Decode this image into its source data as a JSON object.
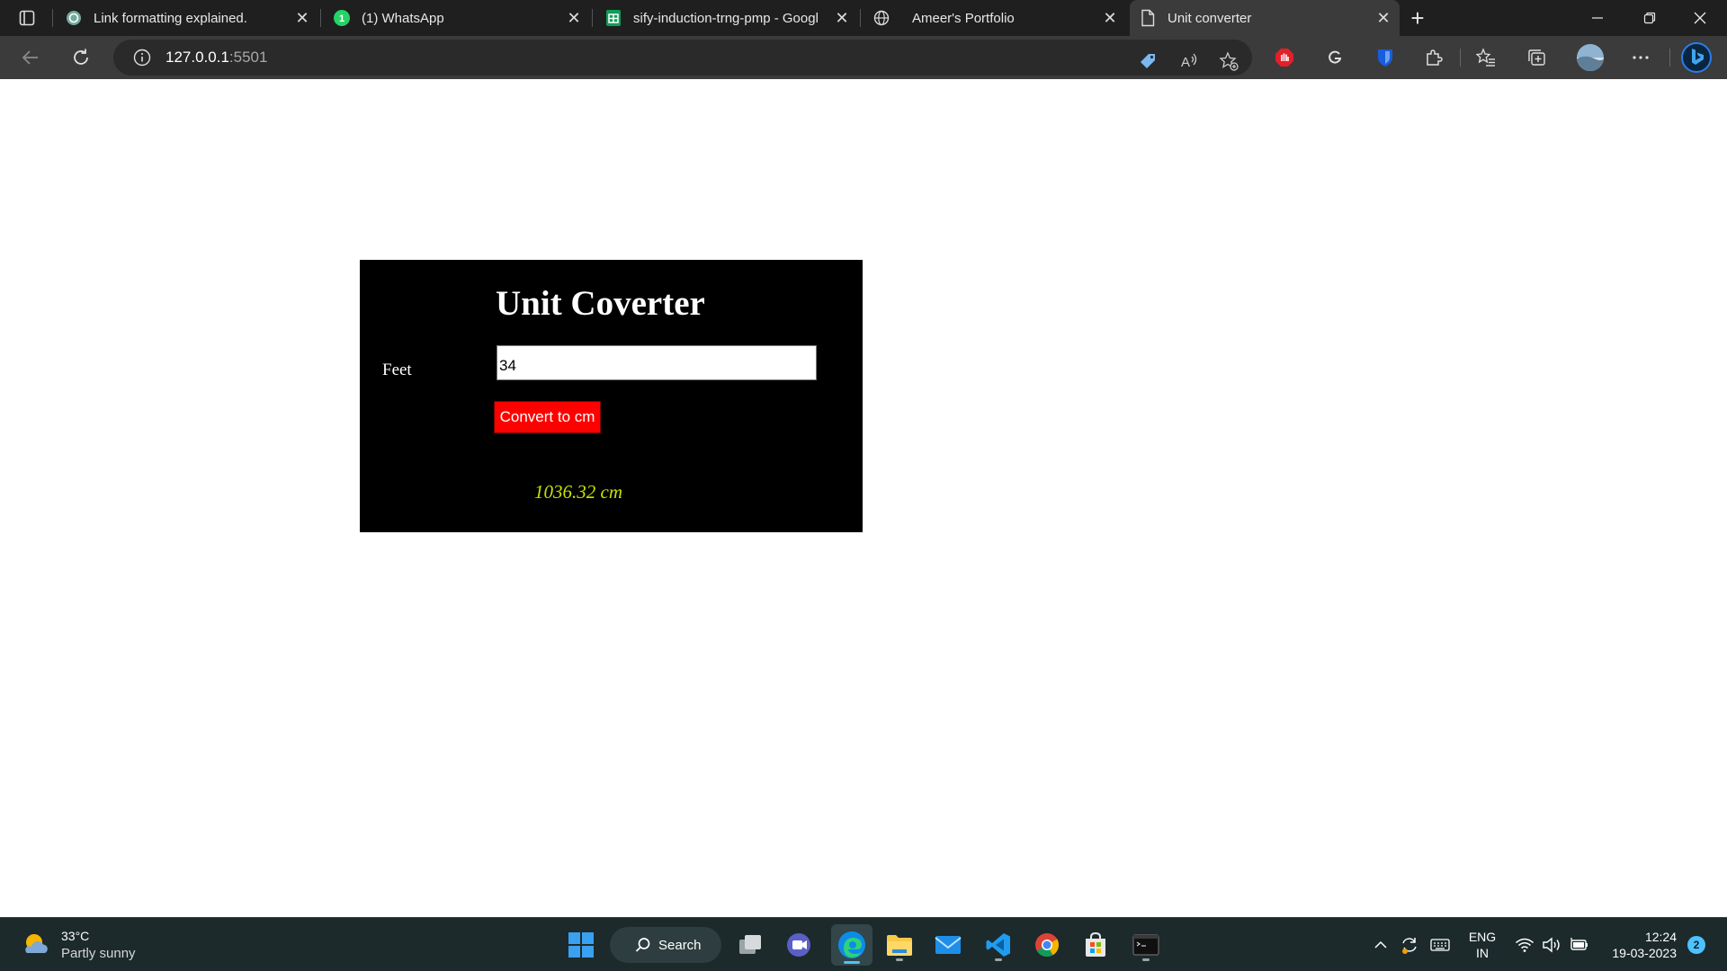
{
  "browser": {
    "tabs": [
      {
        "title": "Link formatting explained.",
        "icon": "chatgpt-icon",
        "active": false
      },
      {
        "title": "(1) WhatsApp",
        "icon": "whatsapp-icon",
        "active": false
      },
      {
        "title": "sify-induction-trng-pmp - Googl",
        "icon": "google-sheets-icon",
        "active": false
      },
      {
        "title": "Ameer's Portfolio",
        "icon": "globe-icon",
        "active": false
      },
      {
        "title": "Unit converter",
        "icon": "page-icon",
        "active": true
      }
    ],
    "address": {
      "host": "127.0.0.1",
      "port": ":5501"
    }
  },
  "converter": {
    "title": "Unit Coverter",
    "label": "Feet",
    "input_value": "34",
    "button_label": "Convert to cm",
    "result": "1036.32 cm"
  },
  "taskbar": {
    "weather": {
      "temp": "33°C",
      "desc": "Partly sunny"
    },
    "search_label": "Search",
    "language": {
      "line1": "ENG",
      "line2": "IN"
    },
    "clock": {
      "time": "12:24",
      "date": "19-03-2023"
    },
    "notifications": "2"
  },
  "colors": {
    "panel": "#000000",
    "button": "#ff0000",
    "result": "#c8e000"
  }
}
